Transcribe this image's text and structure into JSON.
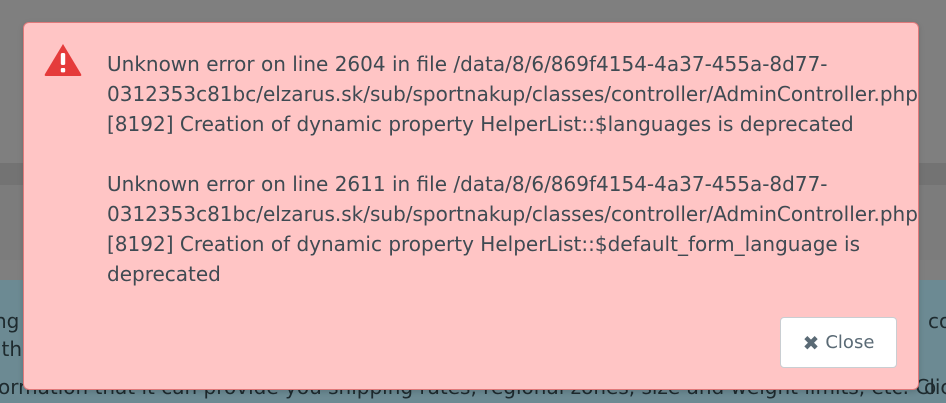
{
  "background": {
    "line_1_left": "ng",
    "line_2_left": "ith",
    "line_1_right": "co",
    "bottom_text": "ormation that it can provide you shipping rates, regional zones, size and weight limits, etc. Click",
    "bottom_right": "o"
  },
  "dialog": {
    "icon": "warning-triangle-icon",
    "errors": [
      {
        "lines": [
          "Unknown error on line 2604 in file /data/8/6/869f4154-4a37-455a-8d77-",
          "0312353c81bc/elzarus.sk/sub/sportnakup/classes/controller/AdminController.php",
          "[8192] Creation of dynamic property HelperList::$languages is deprecated"
        ]
      },
      {
        "lines": [
          "Unknown error on line 2611 in file /data/8/6/869f4154-4a37-455a-8d77-",
          "0312353c81bc/elzarus.sk/sub/sportnakup/classes/controller/AdminController.php",
          "[8192] Creation of dynamic property HelperList::$default_form_language is",
          "deprecated"
        ]
      }
    ],
    "close_icon": "✖",
    "close_label": "Close"
  },
  "colors": {
    "dialog_bg": "#ffc5c5",
    "warning": "#e53b3b",
    "text": "#3f4a52"
  }
}
